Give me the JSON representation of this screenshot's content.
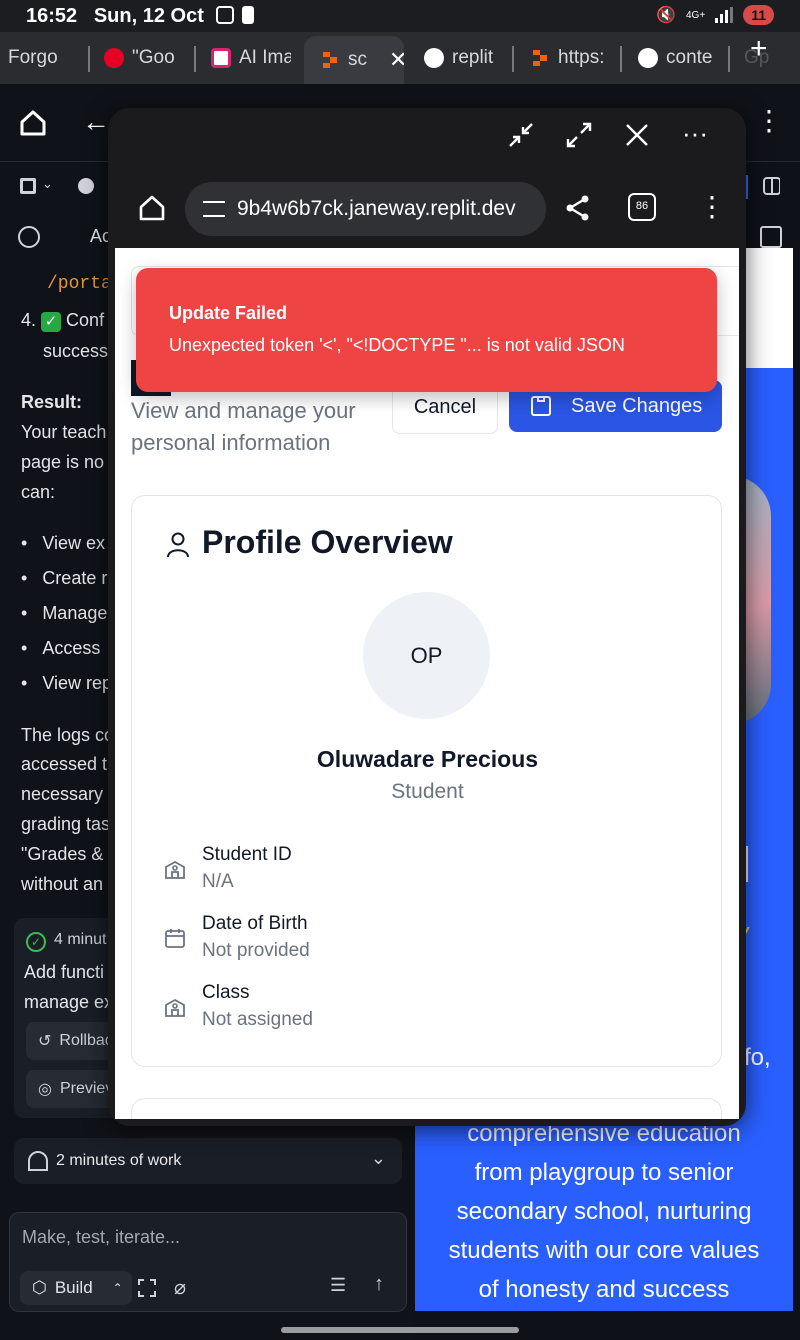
{
  "status_bar": {
    "time": "16:52",
    "date": "Sun, 12 Oct",
    "network": "4G+",
    "battery": "11"
  },
  "browser_tabs": [
    {
      "label": "Forgo",
      "favicon_color": "#3a3b3f"
    },
    {
      "label": "\"Goo",
      "favicon_color": "#e60023"
    },
    {
      "label": "AI Ima",
      "favicon_color": "#ffffff"
    },
    {
      "label": "sc",
      "favicon_color": "#f26207",
      "active": true
    },
    {
      "label": "replit",
      "favicon_color": "#ffffff"
    },
    {
      "label": "https:",
      "favicon_color": "#f26207"
    },
    {
      "label": "conte",
      "favicon_color": "#ffffff"
    },
    {
      "label": "Gp",
      "favicon_color": "#3a3b3f"
    }
  ],
  "app": {
    "toolbar_initial": "Ac",
    "chat_lines": {
      "path": "/porta",
      "step4_num": "4.",
      "step4_a": "Conf",
      "step4_b": "success",
      "result_heading": "Result:",
      "para1_l1": "Your teach",
      "para1_l2": "page is no",
      "para1_l3": "can:",
      "bullets": [
        "View ex",
        "Create r",
        "Manage",
        "Access",
        "View rep"
      ],
      "para2": [
        "The logs co",
        "accessed t",
        "necessary",
        "grading tas",
        "\"Grades &",
        "without an"
      ]
    },
    "card": {
      "time": "4 minut",
      "text_l1": "Add functi",
      "text_l2": "manage ex",
      "rollback": "Rollbac",
      "preview": "Previev"
    },
    "work_summary": "2 minutes of work",
    "composer_placeholder": "Make, test, iterate...",
    "build_label": "Build"
  },
  "site": {
    "hero_lines": [
      "comprehensive education",
      "from playgroup to senior",
      "secondary school, nurturing",
      "students with our core values",
      "of honesty and success"
    ],
    "partial_fo": "fo,",
    "partial_slash": "/"
  },
  "popup": {
    "url": "9b4w6b7ck.janeway.replit.dev",
    "page": {
      "subtitle_l1": "View and manage your",
      "subtitle_l2": "personal information",
      "cancel_label": "Cancel",
      "save_label": "Save Changes",
      "card_title": "Profile Overview",
      "avatar_initials": "OP",
      "name": "Oluwadare Precious",
      "role": "Student",
      "fields": [
        {
          "label": "Student ID",
          "value": "N/A",
          "icon": "school-icon"
        },
        {
          "label": "Date of Birth",
          "value": "Not provided",
          "icon": "calendar-icon"
        },
        {
          "label": "Class",
          "value": "Not assigned",
          "icon": "school-icon"
        }
      ]
    },
    "toast": {
      "title": "Update Failed",
      "message": "Unexpected token '<', \"<!DOCTYPE \"... is not valid JSON"
    }
  },
  "colors": {
    "toast": "#ef4444",
    "primary": "#2a55e5",
    "site_hero": "#2a5fff"
  }
}
